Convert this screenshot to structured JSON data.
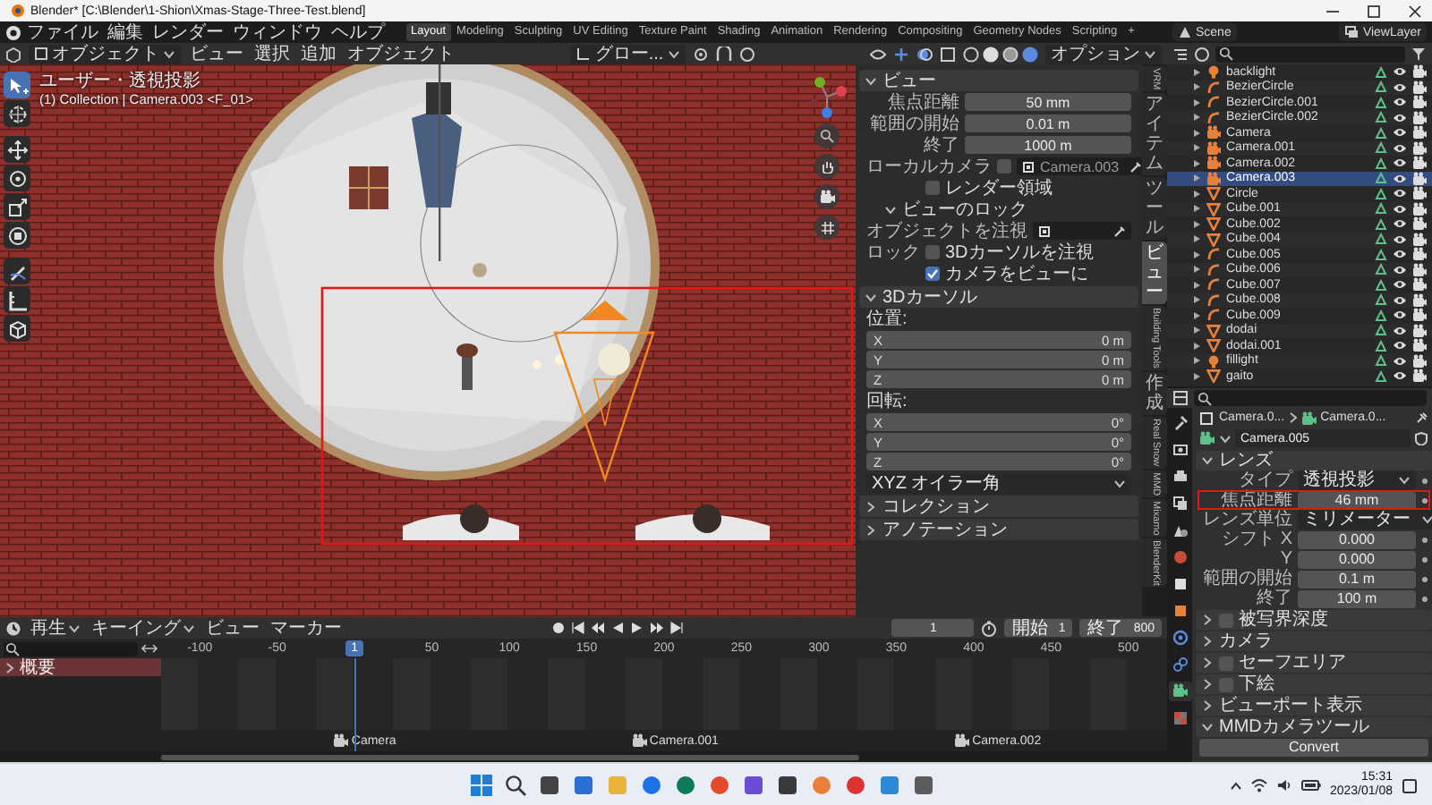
{
  "window": {
    "title": "Blender* [C:\\Blender\\1-Shion\\Xmas-Stage-Three-Test.blend]"
  },
  "menu": [
    "ファイル",
    "編集",
    "レンダー",
    "ウィンドウ",
    "ヘルプ"
  ],
  "workspaces": [
    {
      "label": "Layout",
      "selected": true
    },
    {
      "label": "Modeling",
      "selected": false
    },
    {
      "label": "Sculpting",
      "selected": false
    },
    {
      "label": "UV Editing",
      "selected": false
    },
    {
      "label": "Texture Paint",
      "selected": false
    },
    {
      "label": "Shading",
      "selected": false
    },
    {
      "label": "Animation",
      "selected": false
    },
    {
      "label": "Rendering",
      "selected": false
    },
    {
      "label": "Compositing",
      "selected": false
    },
    {
      "label": "Geometry Nodes",
      "selected": false
    },
    {
      "label": "Scripting",
      "selected": false
    }
  ],
  "add_workspace": "+",
  "scene": "Scene",
  "view_layer": "ViewLayer",
  "viewport": {
    "mode": "オブジェクト",
    "menus": [
      "ビュー",
      "選択",
      "追加",
      "オブジェクト"
    ],
    "orientation": "グロー...",
    "options": "オプション",
    "view_name": "ユーザー・透視投影",
    "context": "(1) Collection | Camera.003 <F_01>",
    "tools": [
      {
        "kind": "select",
        "selected": true
      },
      {
        "kind": "cursor",
        "selected": false
      },
      {
        "kind": "move",
        "selected": false
      },
      {
        "kind": "rotate",
        "selected": false
      },
      {
        "kind": "scale",
        "selected": false
      },
      {
        "kind": "transform",
        "selected": false
      },
      {
        "kind": "annotate",
        "selected": false
      },
      {
        "kind": "measure",
        "selected": false
      },
      {
        "kind": "add",
        "selected": false
      }
    ]
  },
  "n_panel": {
    "sections": [
      {
        "title": "ビュー",
        "expanded": true,
        "rows": [
          {
            "kind": "field",
            "label": "焦点距離",
            "value": "50 mm"
          },
          {
            "kind": "field",
            "label": "範囲の開始",
            "value": "0.01 m"
          },
          {
            "kind": "field",
            "label": "終了",
            "value": "1000 m"
          },
          {
            "kind": "object",
            "label": "ローカルカメラ",
            "checked": false,
            "value": "Camera.003"
          },
          {
            "kind": "check",
            "text": "レンダー領域",
            "checked": false
          },
          {
            "kind": "subheader",
            "text": "ビューのロック",
            "expanded": true
          },
          {
            "kind": "object",
            "label": "オブジェクトを注視"
          },
          {
            "kind": "check",
            "label": "ロック",
            "text": "3Dカーソルを注視",
            "checked": false
          },
          {
            "kind": "check",
            "text": "カメラをビューに",
            "checked": true
          }
        ]
      },
      {
        "title": "3Dカーソル",
        "expanded": true,
        "rows": [
          {
            "kind": "caption",
            "text": "位置:"
          },
          {
            "kind": "vector",
            "items": [
              {
                "axis": "X",
                "value": "0 m"
              },
              {
                "axis": "Y",
                "value": "0 m"
              },
              {
                "axis": "Z",
                "value": "0 m"
              }
            ]
          },
          {
            "kind": "caption",
            "text": "回転:"
          },
          {
            "kind": "vector",
            "items": [
              {
                "axis": "X",
                "value": "0°"
              },
              {
                "axis": "Y",
                "value": "0°"
              },
              {
                "axis": "Z",
                "value": "0°"
              }
            ]
          },
          {
            "kind": "dropdown",
            "value": "XYZ オイラー角"
          }
        ]
      },
      {
        "title": "コレクション",
        "expanded": false
      },
      {
        "title": "アノテーション",
        "expanded": false
      }
    ]
  },
  "sidebar_tabs": [
    {
      "label": "VRM",
      "kind": "latin",
      "selected": false
    },
    {
      "label": "アイテム",
      "kind": "cjk",
      "selected": false
    },
    {
      "label": "ツール",
      "kind": "cjk",
      "selected": false
    },
    {
      "label": "ビュー",
      "kind": "cjk",
      "selected": true
    },
    {
      "label": "Building Tools",
      "kind": "latin",
      "selected": false
    },
    {
      "label": "作成",
      "kind": "cjk",
      "selected": false
    },
    {
      "label": "Real Snow",
      "kind": "latin",
      "selected": false
    },
    {
      "label": "MMD",
      "kind": "latin",
      "selected": false
    },
    {
      "label": "Mixamo",
      "kind": "latin",
      "selected": false
    },
    {
      "label": "BlenderKit",
      "kind": "latin",
      "selected": false
    }
  ],
  "outliner": {
    "items": [
      {
        "name": "backlight",
        "kind": "light",
        "selected": false
      },
      {
        "name": "BezierCircle",
        "kind": "curve",
        "selected": false
      },
      {
        "name": "BezierCircle.001",
        "kind": "curve",
        "selected": false
      },
      {
        "name": "BezierCircle.002",
        "kind": "curve",
        "selected": false
      },
      {
        "name": "Camera",
        "kind": "camera",
        "selected": false
      },
      {
        "name": "Camera.001",
        "kind": "camera",
        "selected": false
      },
      {
        "name": "Camera.002",
        "kind": "camera",
        "selected": false
      },
      {
        "name": "Camera.003",
        "kind": "camera",
        "selected": true
      },
      {
        "name": "Circle",
        "kind": "mesh",
        "selected": false
      },
      {
        "name": "Cube.001",
        "kind": "mesh",
        "selected": false
      },
      {
        "name": "Cube.002",
        "kind": "mesh",
        "selected": false
      },
      {
        "name": "Cube.004",
        "kind": "mesh",
        "selected": false
      },
      {
        "name": "Cube.005",
        "kind": "curve",
        "selected": false
      },
      {
        "name": "Cube.006",
        "kind": "curve",
        "selected": false
      },
      {
        "name": "Cube.007",
        "kind": "curve",
        "selected": false
      },
      {
        "name": "Cube.008",
        "kind": "curve",
        "selected": false
      },
      {
        "name": "Cube.009",
        "kind": "curve",
        "selected": false
      },
      {
        "name": "dodai",
        "kind": "mesh",
        "selected": false
      },
      {
        "name": "dodai.001",
        "kind": "mesh",
        "selected": false
      },
      {
        "name": "fillight",
        "kind": "light",
        "selected": false
      },
      {
        "name": "gaito",
        "kind": "mesh",
        "selected": false
      }
    ]
  },
  "properties": {
    "tabs": [
      {
        "kind": "tool",
        "selected": false
      },
      {
        "kind": "render",
        "selected": false
      },
      {
        "kind": "output",
        "selected": false
      },
      {
        "kind": "view_layer",
        "selected": false
      },
      {
        "kind": "scene",
        "selected": false
      },
      {
        "kind": "world",
        "selected": false
      },
      {
        "kind": "collection",
        "selected": false
      },
      {
        "kind": "object",
        "selected": false
      },
      {
        "kind": "physics",
        "selected": false
      },
      {
        "kind": "constraints",
        "selected": false
      },
      {
        "kind": "data",
        "selected": true
      },
      {
        "kind": "texture",
        "selected": false
      }
    ],
    "breadcrumb": [
      "Camera.0...",
      "Camera.0..."
    ],
    "datablock": "Camera.005",
    "sections": [
      {
        "title": "レンズ",
        "expanded": true,
        "rows": [
          {
            "kind": "dropdown",
            "label": "タイプ",
            "value": "透視投影"
          },
          {
            "kind": "field",
            "label": "焦点距離",
            "value": "46 mm",
            "highlighted": true
          },
          {
            "kind": "dropdown",
            "label": "レンズ単位",
            "value": "ミリメーター"
          },
          {
            "kind": "field",
            "label": "シフト X",
            "value": "0.000"
          },
          {
            "kind": "field",
            "label": "Y",
            "value": "0.000"
          },
          {
            "kind": "field",
            "label": "範囲の開始",
            "value": "0.1 m"
          },
          {
            "kind": "field",
            "label": "終了",
            "value": "100 m"
          }
        ]
      },
      {
        "title": "被写界深度",
        "expanded": false,
        "checked": false
      },
      {
        "title": "カメラ",
        "expanded": false
      },
      {
        "title": "セーフエリア",
        "expanded": false,
        "checked": false
      },
      {
        "title": "下絵",
        "expanded": false,
        "checked": false
      },
      {
        "title": "ビューポート表示",
        "expanded": false
      },
      {
        "title": "MMDカメラツール",
        "expanded": true,
        "rows": [
          {
            "kind": "button",
            "label": "Convert"
          }
        ]
      }
    ]
  },
  "timeline": {
    "menus": [
      {
        "label": "再生",
        "dropdown": true
      },
      {
        "label": "キーイング",
        "dropdown": true
      },
      {
        "label": "ビュー",
        "dropdown": false
      },
      {
        "label": "マーカー",
        "dropdown": false
      }
    ],
    "current_frame": "1",
    "start_label": "開始",
    "start": "1",
    "end_label": "終了",
    "end": "800",
    "ticks": [
      "-100",
      "-50",
      "50",
      "100",
      "150",
      "200",
      "250",
      "300",
      "350",
      "400",
      "450",
      "500"
    ],
    "playhead": "1",
    "channels": [
      {
        "name": "概要",
        "expanded": false
      }
    ],
    "markers": [
      "Camera",
      "Camera.001",
      "Camera.002"
    ]
  },
  "taskbar": {
    "time": "15:31",
    "date": "2023/01/08"
  }
}
